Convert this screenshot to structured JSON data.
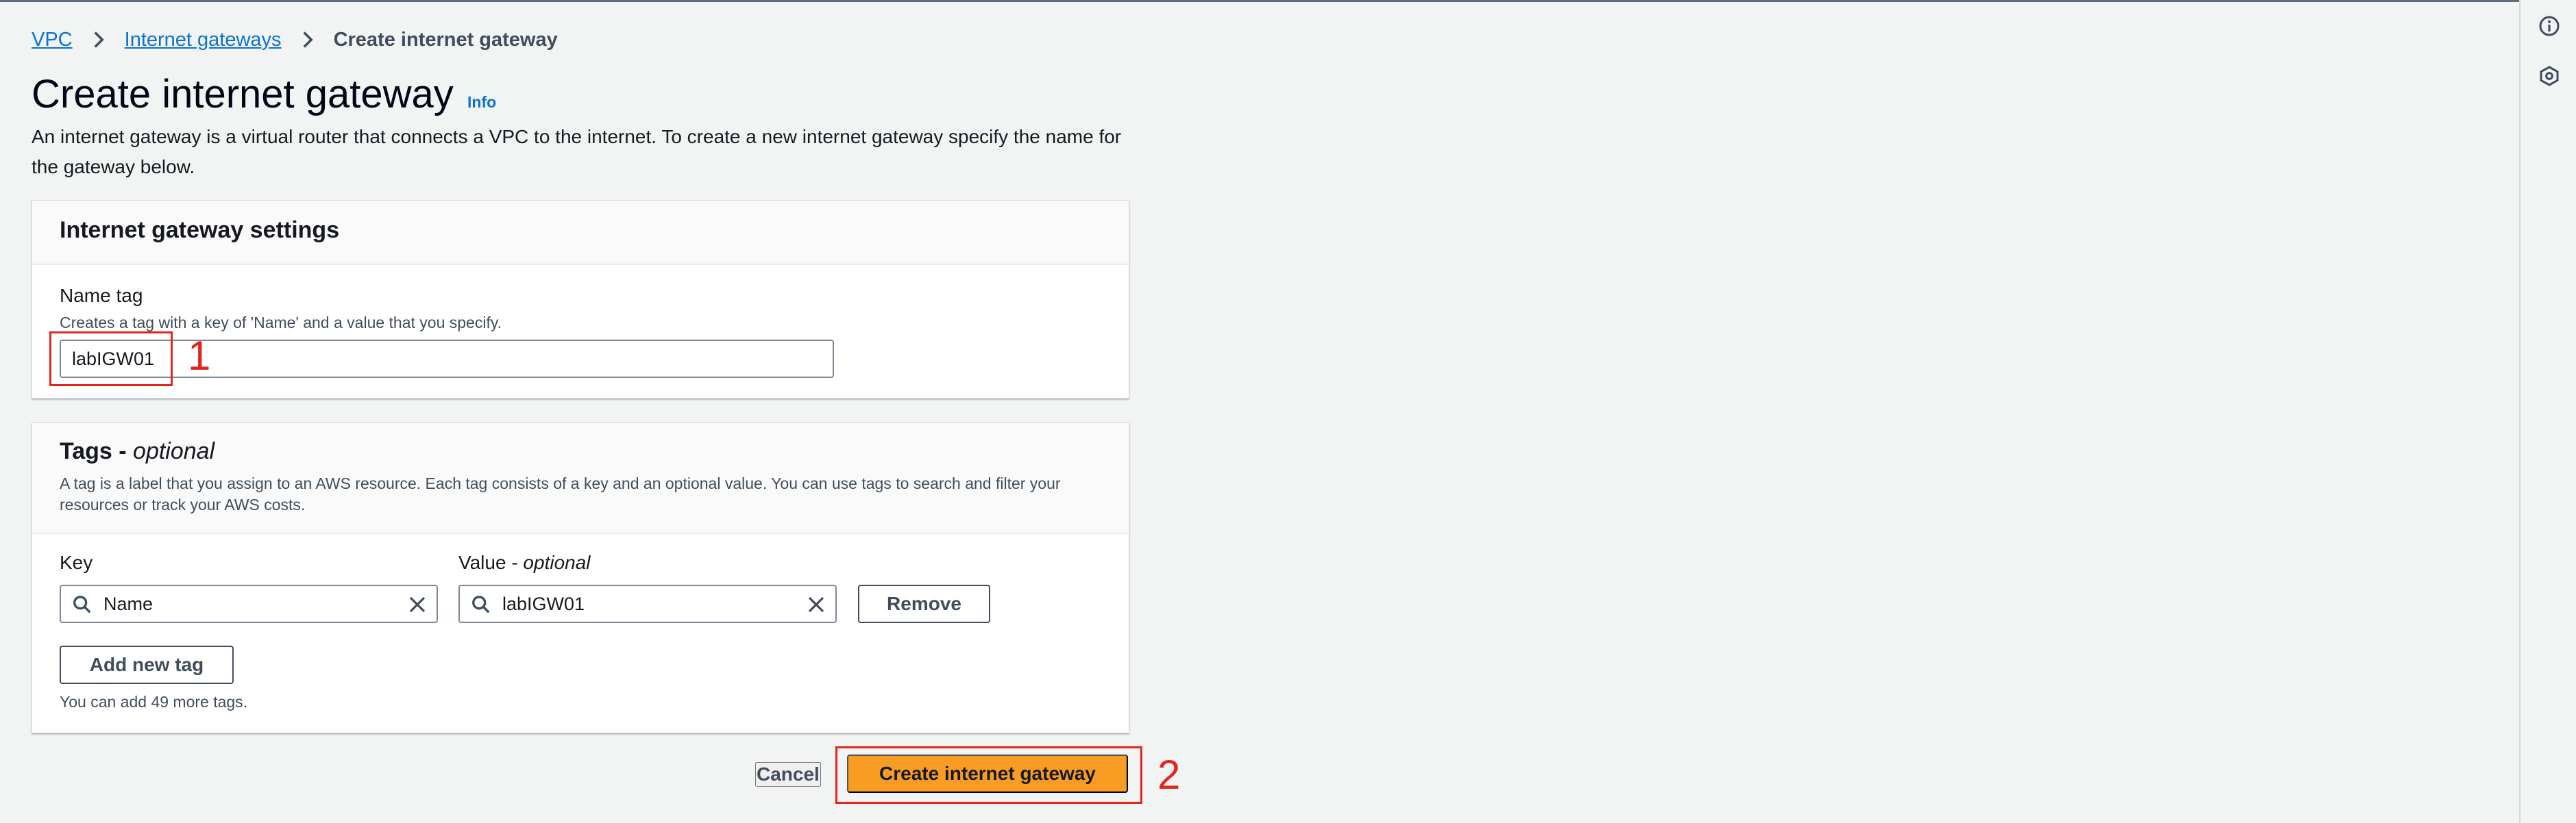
{
  "breadcrumb": {
    "items": [
      "VPC",
      "Internet gateways"
    ],
    "current": "Create internet gateway"
  },
  "header": {
    "title": "Create internet gateway",
    "info": "Info",
    "description": "An internet gateway is a virtual router that connects a VPC to the internet. To create a new internet gateway specify the name for the gateway below."
  },
  "settings": {
    "title": "Internet gateway settings",
    "name_label": "Name tag",
    "name_hint": "Creates a tag with a key of 'Name' and a value that you specify.",
    "name_value": "labIGW01"
  },
  "tags": {
    "title": "Tags - ",
    "title_optional": "optional",
    "description": "A tag is a label that you assign to an AWS resource. Each tag consists of a key and an optional value. You can use tags to search and filter your resources or track your AWS costs.",
    "key_label": "Key",
    "value_label": "Value - ",
    "value_label_optional": "optional",
    "key_value": "Name",
    "value_value": "labIGW01",
    "remove_label": "Remove",
    "add_label": "Add new tag",
    "remaining": "You can add 49 more tags."
  },
  "footer": {
    "cancel_label": "Cancel",
    "create_label": "Create internet gateway"
  },
  "annotations": [
    "1",
    "2"
  ],
  "icons": {
    "breadcrumb_separator": "chevron-right-icon",
    "search": "search-icon",
    "clear": "close-icon",
    "rail_info": "info-icon",
    "rail_secondary": "hexagon-settings-icon"
  },
  "colors": {
    "primary_button": "#f89c24",
    "link": "#0972d3",
    "annotation": "#e2261d",
    "background": "#f2f3f3"
  }
}
